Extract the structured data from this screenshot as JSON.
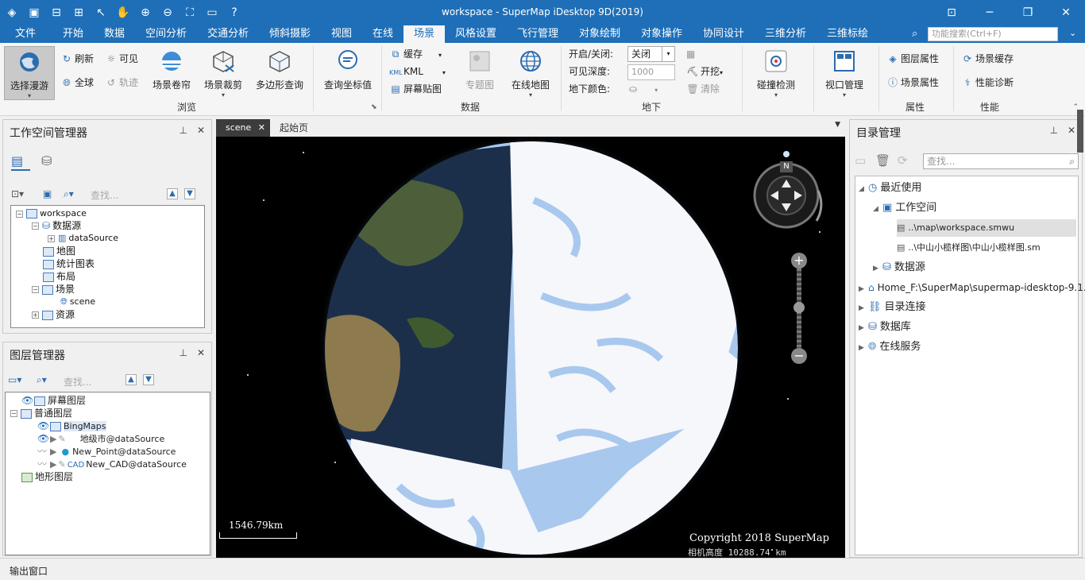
{
  "window": {
    "title": "workspace - SuperMap iDesktop 9D(2019)"
  },
  "menu": {
    "items": [
      "文件",
      "开始",
      "数据",
      "空间分析",
      "交通分析",
      "倾斜摄影",
      "视图",
      "在线",
      "场景",
      "风格设置",
      "飞行管理",
      "对象绘制",
      "对象操作",
      "协同设计",
      "三维分析",
      "三维标绘"
    ],
    "active": "场景",
    "search_placeholder": "功能搜索(Ctrl+F)"
  },
  "ribbon": {
    "browse": {
      "group": "浏览",
      "select_roam": "选择漫游",
      "refresh": "刷新",
      "visible": "可见",
      "globe": "全球",
      "track": "轨迹",
      "scene_roller": "场景卷帘",
      "scene_clip": "场景裁剪",
      "polygon_query": "多边形查询",
      "query_coord": "查询坐标值"
    },
    "data": {
      "group": "数据",
      "cache": "缓存",
      "kml": "KML",
      "screen_map": "屏幕贴图",
      "thematic": "专题图",
      "online_map": "在线地图"
    },
    "underground": {
      "group": "地下",
      "toggle_label": "开启/关闭:",
      "toggle_value": "关闭",
      "depth_label": "可见深度:",
      "depth_value": "1000",
      "color_label": "地下颜色:",
      "excavate": "开挖",
      "clear": "清除"
    },
    "collision": "碰撞检测",
    "viewport": "视口管理",
    "properties": {
      "group": "属性",
      "layer_props": "图层属性",
      "scene_props": "场景属性"
    },
    "performance": {
      "group": "性能",
      "scene_cache": "场景缓存",
      "perf_diag": "性能诊断"
    }
  },
  "workspace_panel": {
    "title": "工作空间管理器",
    "search_placeholder": "查找...",
    "tree": {
      "workspace": "workspace",
      "datasources": "数据源",
      "datasource": "dataSource",
      "maps": "地图",
      "charts": "统计图表",
      "layouts": "布局",
      "scenes": "场景",
      "scene": "scene",
      "resources": "资源"
    }
  },
  "layer_panel": {
    "title": "图层管理器",
    "search_placeholder": "查找...",
    "screen_layers": "屏幕图层",
    "normal_layers": "普通图层",
    "layers": [
      "BingMaps",
      "地级市@dataSource",
      "New_Point@dataSource",
      "New_CAD@dataSource"
    ],
    "terrain_layers": "地形图层"
  },
  "doc_tabs": {
    "active": "scene",
    "other": "起始页"
  },
  "scene": {
    "scale_label": "1546.79km",
    "copyright": "Copyright 2018 SuperMap",
    "camera_height": "相机高度 10288.74 km",
    "compass_north": "N"
  },
  "catalog_panel": {
    "title": "目录管理",
    "search_placeholder": "查找...",
    "recent": "最近使用",
    "workspaces": "工作空间",
    "ws_file1": "..\\map\\workspace.smwu",
    "ws_file2": "..\\中山小榄样图\\中山小榄样图.sm",
    "datasources": "数据源",
    "home": "Home_F:\\SuperMap\\supermap-idesktop-9.1....",
    "dir_link": "目录连接",
    "database": "数据库",
    "online_service": "在线服务"
  },
  "status": {
    "output": "输出窗口"
  },
  "colors": {
    "accent": "#1e6fb8",
    "ribbon": "#f5f5f5",
    "ocean": "#a9c8ee",
    "land": "#f5f7fb"
  }
}
